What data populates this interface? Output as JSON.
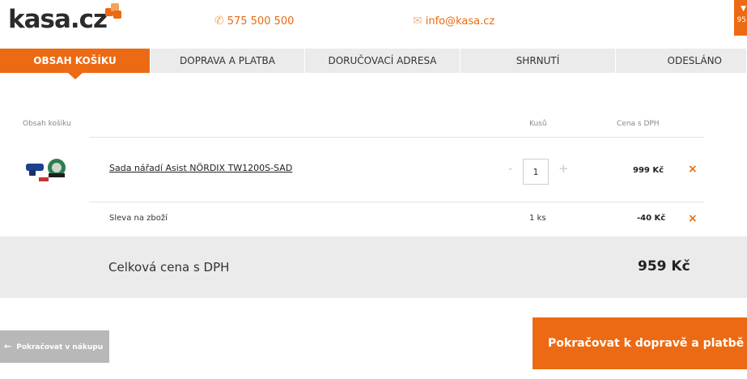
{
  "header": {
    "logo": "kasa.cz",
    "phone": "575 500 500",
    "email": "info@kasa.cz",
    "cart_amount": "95",
    "icons": {
      "phone": "phone-icon",
      "email": "envelope-icon",
      "cart": "cart-icon",
      "logo_mark": "logo-cubes-icon"
    }
  },
  "steps": [
    {
      "label": "OBSAH KOŠÍKU",
      "active": true
    },
    {
      "label": "DOPRAVA A PLATBA",
      "active": false
    },
    {
      "label": "DORUČOVACÍ ADRESA",
      "active": false
    },
    {
      "label": "SHRNUTÍ",
      "active": false
    },
    {
      "label": "ODESLÁNO",
      "active": false
    }
  ],
  "cart": {
    "columns": {
      "name": "Obsah košíku",
      "qty": "Kusů",
      "price": "Cena s DPH"
    },
    "items": [
      {
        "name": "Sada nářadí Asist NÖRDIX TW1200S-SAD",
        "quantity": "1",
        "minus": "-",
        "plus": "+",
        "price": "999 Kč",
        "remove": "×"
      }
    ],
    "discount": {
      "name": "Sleva na zboží",
      "quantity": "1 ks",
      "price": "-40 Kč",
      "remove": "×"
    },
    "total": {
      "label": "Celková cena s DPH",
      "value": "959 Kč"
    }
  },
  "actions": {
    "back_label": "Pokračovat v nákupu",
    "back_arrow": "←",
    "next_label": "Pokračovat k dopravě a platbě",
    "next_arrow": "→"
  },
  "colors": {
    "accent": "#ec6a13",
    "step_bg": "#ebebeb",
    "back_button": "#b8b8b8"
  }
}
